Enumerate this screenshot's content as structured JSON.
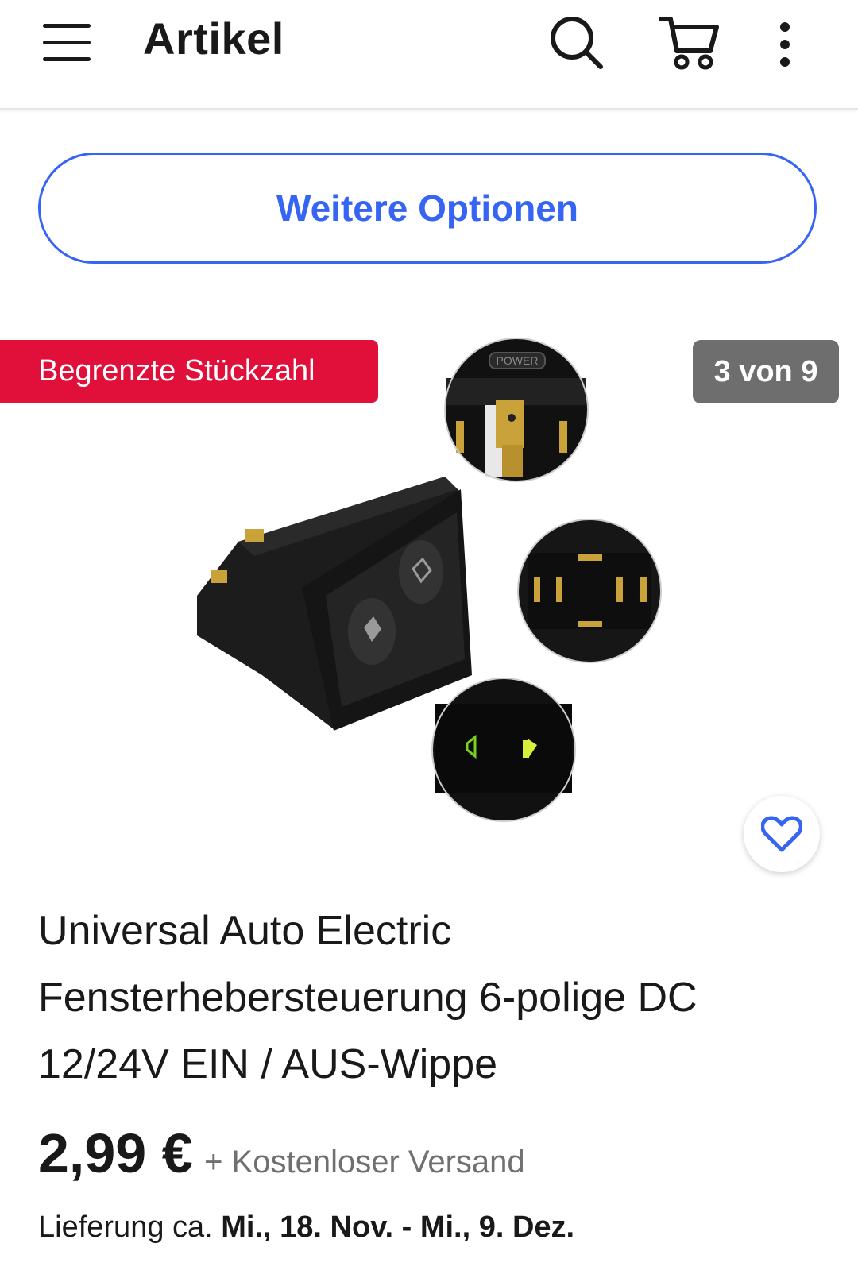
{
  "appbar": {
    "title": "Artikel",
    "menu_icon": "hamburger-menu-icon",
    "search_icon": "search-icon",
    "cart_icon": "cart-icon",
    "more_icon": "more-vertical-icon"
  },
  "options_button": {
    "label": "Weitere Optionen"
  },
  "gallery": {
    "badge": "Begrenzte Stückzahl",
    "counter": "3 von 9",
    "image_text": "POWER",
    "favorite_icon": "heart-icon"
  },
  "product": {
    "title": "Universal Auto Electric Fensterhebersteuerung 6-polige DC 12/24V EIN / AUS-Wippe",
    "price": "2,99 €",
    "shipping": "+ Kostenloser Versand",
    "delivery_label": "Lieferung ca.",
    "delivery_dates": "Mi., 18. Nov. - Mi., 9. Dez."
  },
  "colors": {
    "accent": "#3665f3",
    "badge_red": "#e0103a",
    "counter_gray": "#6e6e6e"
  }
}
